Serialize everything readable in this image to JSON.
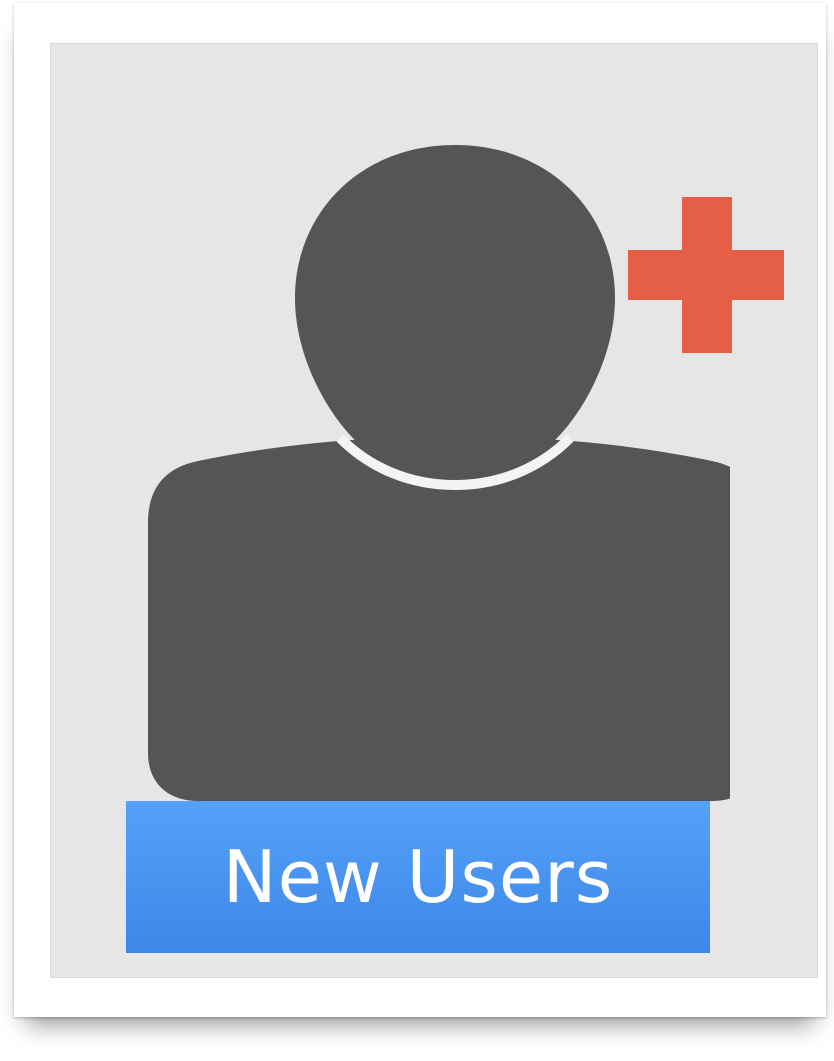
{
  "tile": {
    "label": "New Users"
  },
  "icons": {
    "user": "user-silhouette-icon",
    "plus": "plus-icon"
  },
  "colors": {
    "panel_background": "#e6e6e6",
    "silhouette": "#555555",
    "plus": "#e55f46",
    "label_background": "#4a94f2",
    "label_text": "#ffffff"
  }
}
